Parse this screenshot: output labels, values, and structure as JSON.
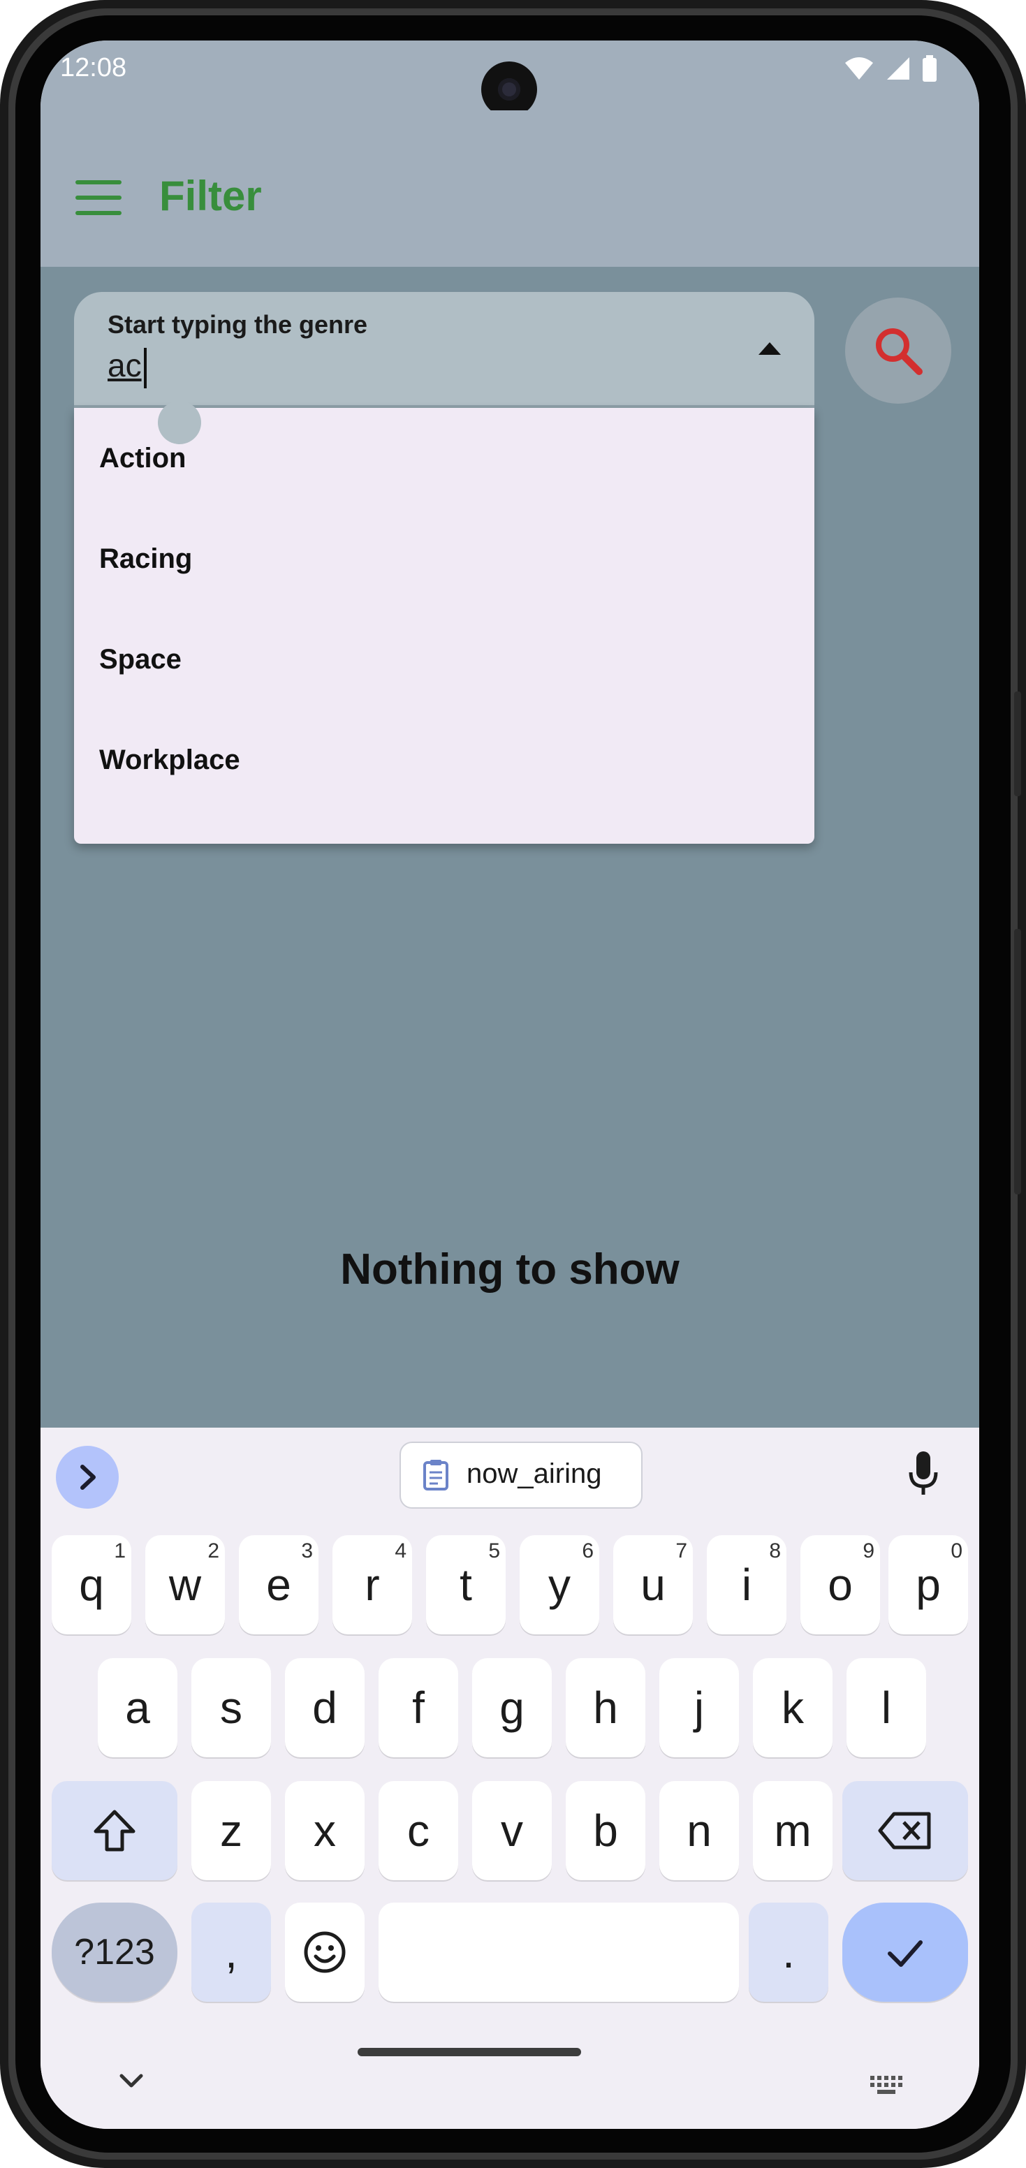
{
  "status_bar": {
    "time": "12:08"
  },
  "app_bar": {
    "title": "Filter"
  },
  "search_field": {
    "label": "Start typing the genre",
    "value": "ac"
  },
  "dropdown": {
    "items": [
      "Action",
      "Racing",
      "Space",
      "Workplace"
    ]
  },
  "empty_state": {
    "text": "Nothing to show"
  },
  "keyboard": {
    "clipboard_chip": "now_airing",
    "row1": [
      "q",
      "w",
      "e",
      "r",
      "t",
      "y",
      "u",
      "i",
      "o",
      "p"
    ],
    "row1_hints": [
      "1",
      "2",
      "3",
      "4",
      "5",
      "6",
      "7",
      "8",
      "9",
      "0"
    ],
    "row2": [
      "a",
      "s",
      "d",
      "f",
      "g",
      "h",
      "j",
      "k",
      "l"
    ],
    "row3": [
      "z",
      "x",
      "c",
      "v",
      "b",
      "n",
      "m"
    ],
    "symbols_label": "?123",
    "comma_label": ",",
    "period_label": "."
  },
  "colors": {
    "app_bar_bg": "#a2afbc",
    "content_bg": "#7a909b",
    "title_accent": "#388e3c",
    "search_icon": "#d32f2f",
    "dropdown_bg": "#f1eaf5",
    "keyboard_bg": "#f1eef5"
  },
  "icons": [
    "menu-icon",
    "dropdown-arrow-icon",
    "search-icon",
    "wifi-icon",
    "signal-icon",
    "battery-icon",
    "expand-icon",
    "clipboard-icon",
    "mic-icon",
    "shift-icon",
    "backspace-icon",
    "emoji-icon",
    "check-icon",
    "chevron-down-icon",
    "keyboard-icon"
  ]
}
